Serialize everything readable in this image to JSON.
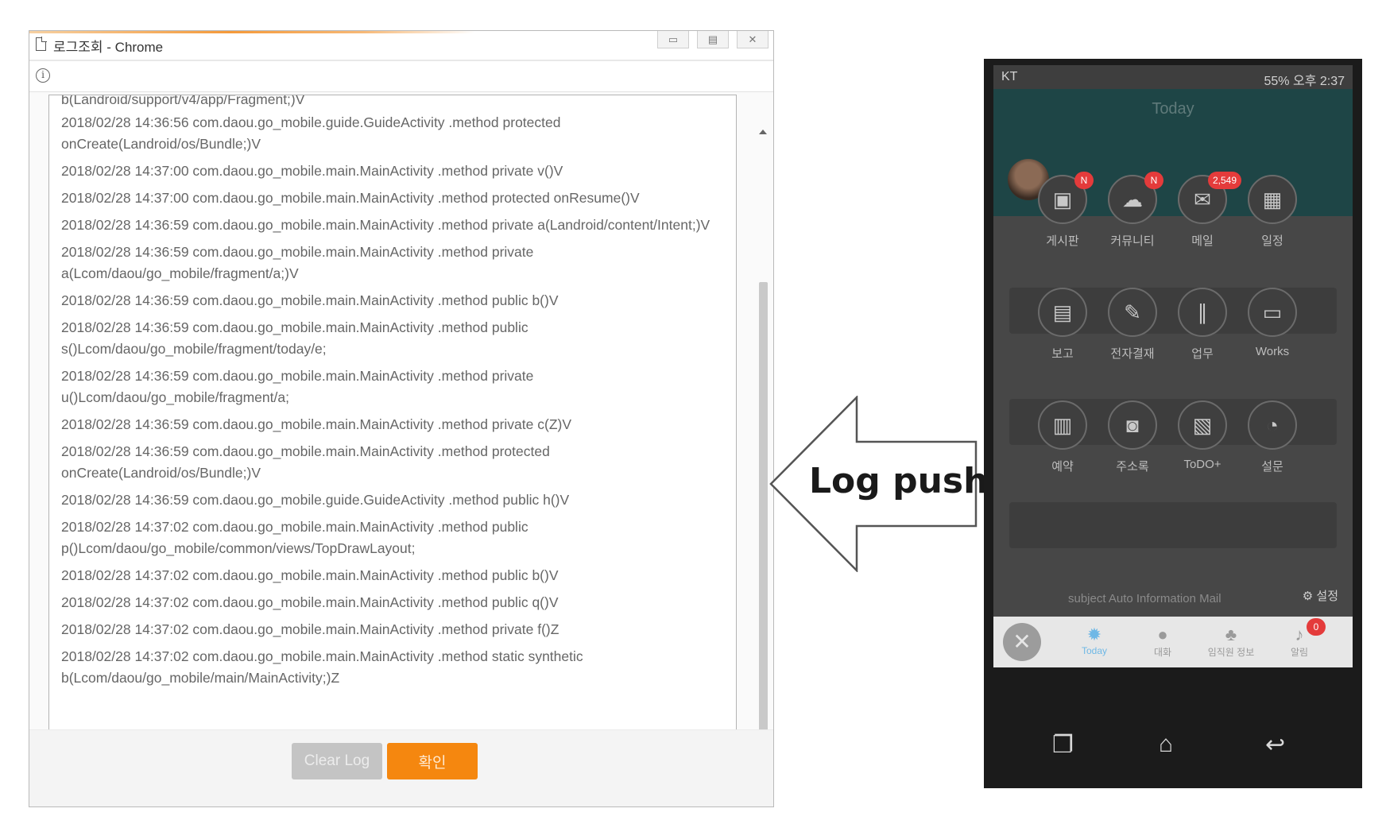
{
  "window": {
    "title": "로그조회 - Chrome",
    "info_icon": "info-icon",
    "buttons": {
      "clear_label": "Clear Log",
      "ok_label": "확인"
    },
    "accent_color": "#f5870f"
  },
  "log": {
    "top_partial": "b(Landroid/support/v4/app/Fragment;)V",
    "lines": [
      "2018/02/28 14:36:56 com.daou.go_mobile.guide.GuideActivity .method protected onCreate(Landroid/os/Bundle;)V",
      "2018/02/28 14:37:00 com.daou.go_mobile.main.MainActivity .method private v()V",
      "2018/02/28 14:37:00 com.daou.go_mobile.main.MainActivity .method protected onResume()V",
      "2018/02/28 14:36:59 com.daou.go_mobile.main.MainActivity .method private a(Landroid/content/Intent;)V",
      "2018/02/28 14:36:59 com.daou.go_mobile.main.MainActivity .method private a(Lcom/daou/go_mobile/fragment/a;)V",
      "2018/02/28 14:36:59 com.daou.go_mobile.main.MainActivity .method public b()V",
      "2018/02/28 14:36:59 com.daou.go_mobile.main.MainActivity .method public s()Lcom/daou/go_mobile/fragment/today/e;",
      "2018/02/28 14:36:59 com.daou.go_mobile.main.MainActivity .method private u()Lcom/daou/go_mobile/fragment/a;",
      "2018/02/28 14:36:59 com.daou.go_mobile.main.MainActivity .method private c(Z)V",
      "2018/02/28 14:36:59 com.daou.go_mobile.main.MainActivity .method protected onCreate(Landroid/os/Bundle;)V",
      "2018/02/28 14:36:59 com.daou.go_mobile.guide.GuideActivity .method public h()V",
      "2018/02/28 14:37:02 com.daou.go_mobile.main.MainActivity .method public p()Lcom/daou/go_mobile/common/views/TopDrawLayout;",
      "2018/02/28 14:37:02 com.daou.go_mobile.main.MainActivity .method public b()V",
      "2018/02/28 14:37:02 com.daou.go_mobile.main.MainActivity .method public q()V",
      "2018/02/28 14:37:02 com.daou.go_mobile.main.MainActivity .method private f()Z",
      "2018/02/28 14:37:02 com.daou.go_mobile.main.MainActivity .method static synthetic b(Lcom/daou/go_mobile/main/MainActivity;)Z"
    ]
  },
  "arrow": {
    "label": "Log push"
  },
  "phone": {
    "status_left": "KT",
    "status_right": "55% 오후 2:37",
    "screen_title": "Today",
    "apps": [
      {
        "label": "게시판",
        "icon": "board-icon",
        "glyph": "▣",
        "badge": "N"
      },
      {
        "label": "커뮤니티",
        "icon": "community-icon",
        "glyph": "☁",
        "badge": "N"
      },
      {
        "label": "메일",
        "icon": "mail-icon",
        "glyph": "✉",
        "badge": "2,549"
      },
      {
        "label": "일정",
        "icon": "calendar-icon",
        "glyph": "▦",
        "badge": ""
      },
      {
        "label": "보고",
        "icon": "report-icon",
        "glyph": "▤",
        "badge": ""
      },
      {
        "label": "전자결재",
        "icon": "approval-icon",
        "glyph": "✎",
        "badge": ""
      },
      {
        "label": "업무",
        "icon": "task-icon",
        "glyph": "∥",
        "badge": ""
      },
      {
        "label": "Works",
        "icon": "works-icon",
        "glyph": "▭",
        "badge": ""
      },
      {
        "label": "예약",
        "icon": "reservation-icon",
        "glyph": "▥",
        "badge": ""
      },
      {
        "label": "주소록",
        "icon": "contacts-icon",
        "glyph": "◙",
        "badge": ""
      },
      {
        "label": "ToDO+",
        "icon": "todo-icon",
        "glyph": "▧",
        "badge": ""
      },
      {
        "label": "설문",
        "icon": "survey-icon",
        "glyph": "◔",
        "badge": ""
      }
    ],
    "settings_label": "설정",
    "subject_text": "subject Auto Information Mail",
    "nav": [
      {
        "label": "Today",
        "icon": "sun-icon",
        "glyph": "✹"
      },
      {
        "label": "대화",
        "icon": "chat-icon",
        "glyph": "●"
      },
      {
        "label": "임직원 정보",
        "icon": "org-chart-icon",
        "glyph": "♣"
      },
      {
        "label": "알림",
        "icon": "bell-icon",
        "glyph": "♪",
        "badge": "0"
      }
    ]
  }
}
